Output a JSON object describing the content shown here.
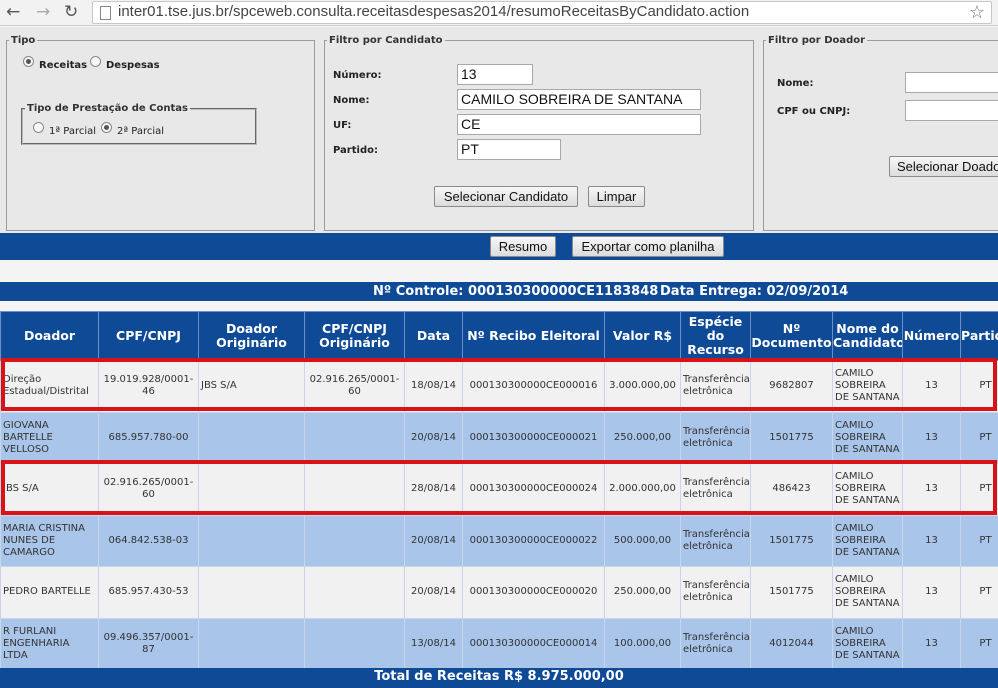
{
  "browser": {
    "url": "inter01.tse.jus.br/spceweb.consulta.receitasdespesas2014/resumoReceitasByCandidato.action"
  },
  "tipo": {
    "legend": "Tipo",
    "receitas": "Receitas",
    "despesas": "Despesas",
    "selected": "Receitas",
    "prestacao": {
      "legend": "Tipo de Prestação de Contas",
      "parcial1": "1ª Parcial",
      "parcial2": "2ª Parcial",
      "selected": "2ª Parcial"
    }
  },
  "filtro_candidato": {
    "legend": "Filtro por Candidato",
    "numero_label": "Número:",
    "numero_value": "13",
    "nome_label": "Nome:",
    "nome_value": "CAMILO SOBREIRA DE SANTANA",
    "uf_label": "UF:",
    "uf_value": "CE",
    "partido_label": "Partido:",
    "partido_value": "PT",
    "selecionar_label": "Selecionar Candidato",
    "limpar_label": "Limpar"
  },
  "filtro_doador": {
    "legend": "Filtro por Doador",
    "nome_label": "Nome:",
    "cpf_label": "CPF ou CNPJ:",
    "selecionar_label": "Selecionar Doador"
  },
  "actions": {
    "resumo": "Resumo",
    "exportar": "Exportar como planilha"
  },
  "info_bar": {
    "controle": "Nº Controle: 000130300000CE1183848",
    "entrega": "Data Entrega: 02/09/2014"
  },
  "table": {
    "headers": [
      "Doador",
      "CPF/CNPJ",
      "Doador Originário",
      "CPF/CNPJ Originário",
      "Data",
      "Nº Recibo Eleitoral",
      "Valor R$",
      "Espécie do Recurso",
      "Nº Documento",
      "Nome do Candidato",
      "Número",
      "Partido"
    ],
    "rows": [
      {
        "doador": "Direção Estadual/Distrital",
        "cpf": "19.019.928/0001-46",
        "doador_orig": "JBS S/A",
        "cpf_orig": "02.916.265/0001-60",
        "data": "18/08/14",
        "recibo": "000130300000CE000016",
        "valor": "3.000.000,00",
        "especie": "Transferência eletrônica",
        "documento": "9682807",
        "candidato": "CAMILO SOBREIRA DE SANTANA",
        "numero": "13",
        "partido": "PT"
      },
      {
        "doador": "GIOVANA BARTELLE VELLOSO",
        "cpf": "685.957.780-00",
        "doador_orig": "",
        "cpf_orig": "",
        "data": "20/08/14",
        "recibo": "000130300000CE000021",
        "valor": "250.000,00",
        "especie": "Transferência eletrônica",
        "documento": "1501775",
        "candidato": "CAMILO SOBREIRA DE SANTANA",
        "numero": "13",
        "partido": "PT"
      },
      {
        "doador": "JBS S/A",
        "cpf": "02.916.265/0001-60",
        "doador_orig": "",
        "cpf_orig": "",
        "data": "28/08/14",
        "recibo": "000130300000CE000024",
        "valor": "2.000.000,00",
        "especie": "Transferência eletrônica",
        "documento": "486423",
        "candidato": "CAMILO SOBREIRA DE SANTANA",
        "numero": "13",
        "partido": "PT"
      },
      {
        "doador": "MARIA CRISTINA NUNES DE CAMARGO",
        "cpf": "064.842.538-03",
        "doador_orig": "",
        "cpf_orig": "",
        "data": "20/08/14",
        "recibo": "000130300000CE000022",
        "valor": "500.000,00",
        "especie": "Transferência eletrônica",
        "documento": "1501775",
        "candidato": "CAMILO SOBREIRA DE SANTANA",
        "numero": "13",
        "partido": "PT"
      },
      {
        "doador": "PEDRO BARTELLE",
        "cpf": "685.957.430-53",
        "doador_orig": "",
        "cpf_orig": "",
        "data": "20/08/14",
        "recibo": "000130300000CE000020",
        "valor": "250.000,00",
        "especie": "Transferência eletrônica",
        "documento": "1501775",
        "candidato": "CAMILO SOBREIRA DE SANTANA",
        "numero": "13",
        "partido": "PT"
      },
      {
        "doador": "R FURLANI ENGENHARIA LTDA",
        "cpf": "09.496.357/0001-87",
        "doador_orig": "",
        "cpf_orig": "",
        "data": "13/08/14",
        "recibo": "000130300000CE000014",
        "valor": "100.000,00",
        "especie": "Transferência eletrônica",
        "documento": "4012044",
        "candidato": "CAMILO SOBREIRA DE SANTANA",
        "numero": "13",
        "partido": "PT"
      }
    ]
  },
  "total": "Total de Receitas R$ 8.975.000,00",
  "highlight_color": "#d81216",
  "header_color": "#0f4a96"
}
